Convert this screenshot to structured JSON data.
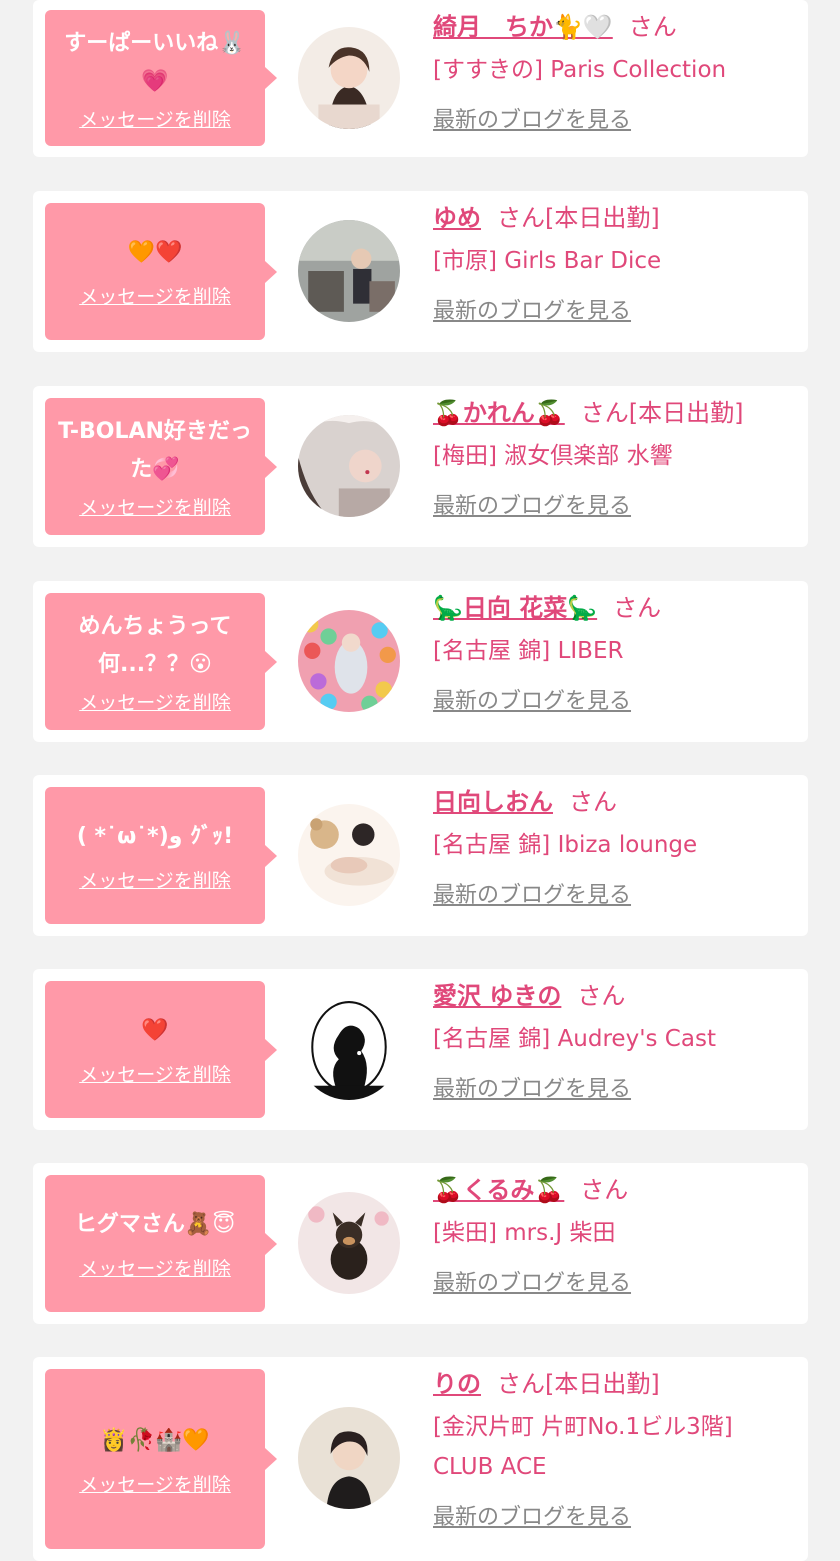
{
  "delete_label": "メッセージを削除",
  "blog_label": "最新のブログを見る",
  "san_label": "さん",
  "colors": {
    "background": "#f2f2f2",
    "card": "#ffffff",
    "bubble": "#ff99a8",
    "accent": "#e0487a",
    "link_gray": "#888888"
  },
  "items": [
    {
      "message": "すーぱーいいね🐰💗",
      "name": "綺月　ちか🐈🤍",
      "suffix": "",
      "shop": "[すすきの] Paris Collection",
      "avatar_icon": "avatar-photo-woman"
    },
    {
      "message": "🧡❤️",
      "name": "ゆめ",
      "suffix": "[本日出勤]",
      "shop": "[市原] Girls Bar Dice",
      "avatar_icon": "avatar-photo-room"
    },
    {
      "message": "T-BOLAN好きだった💞",
      "name": "🍒かれん🍒",
      "suffix": "[本日出勤]",
      "shop": "[梅田] 淑女倶楽部 水響",
      "avatar_icon": "avatar-photo-flowers"
    },
    {
      "message": "めんちょうって何...？？😮",
      "name": "🦕日向 花菜🦕",
      "suffix": "",
      "shop": "[名古屋 錦] LIBER",
      "avatar_icon": "avatar-photo-balls"
    },
    {
      "message": "( *˙ω˙*)و ｸﾞｯ!",
      "name": "日向しおん",
      "suffix": "",
      "shop": "[名古屋 錦] Ibiza lounge",
      "avatar_icon": "avatar-photo-bed"
    },
    {
      "message": "❤️",
      "name": "愛沢 ゆきの",
      "suffix": "",
      "shop": "[名古屋 錦] Audrey's Cast",
      "avatar_icon": "avatar-logo-silhouette"
    },
    {
      "message": "ヒグマさん🧸😇",
      "name": "🍒くるみ🍒",
      "suffix": "",
      "shop": "[柴田] mrs.J 柴田",
      "avatar_icon": "avatar-photo-dog"
    },
    {
      "message": "👸🥀🏰🧡",
      "name": "りの",
      "suffix": "[本日出勤]",
      "shop": "[金沢片町 片町No.1ビル3階] CLUB ACE",
      "avatar_icon": "avatar-photo-portrait"
    }
  ]
}
